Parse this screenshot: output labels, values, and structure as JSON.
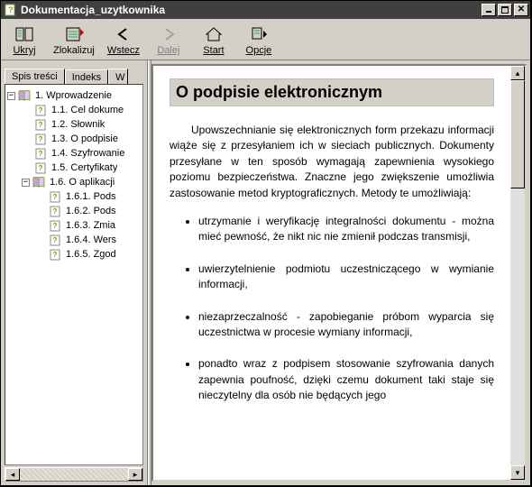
{
  "window": {
    "title": "Dokumentacja_uzytkownika"
  },
  "toolbar": {
    "hide": "Ukryj",
    "locate": "Zlokalizuj",
    "back": "Wstecz",
    "forward": "Dalej",
    "home": "Start",
    "options": "Opcje"
  },
  "tabs": {
    "contents": "Spis treści",
    "index": "Indeks",
    "search_cut": "W"
  },
  "tree": {
    "n1": "1. Wprowadzenie",
    "n11": "1.1. Cel dokume",
    "n12": "1.2. Słownik",
    "n13": "1.3. O podpisie ",
    "n14": "1.4. Szyfrowanie",
    "n15": "1.5. Certyfikaty",
    "n16": "1.6. O aplikacji",
    "n161": "1.6.1. Pods",
    "n162": "1.6.2. Pods",
    "n163": "1.6.3. Zmia",
    "n164": "1.6.4. Wers",
    "n165": "1.6.5. Zgod"
  },
  "page": {
    "heading": "O podpisie elektronicznym",
    "paragraph": "Upowszechnianie się elektronicznych form przekazu informacji wiąże się z przesyłaniem ich w sieciach publicznych. Dokumenty przesyłane w ten sposób wymagają zapewnienia wysokiego poziomu bezpieczeństwa. Znaczne jego zwiększenie umożliwia zastosowanie metod kryptograficznych. Metody te umożliwiają:",
    "li1": "utrzymanie i weryfikację integralności dokumentu - można mieć pewność, że nikt nic nie zmienił podczas transmisji,",
    "li2": "uwierzytelnienie podmiotu uczestniczącego w wymianie informacji,",
    "li3": "niezaprzeczalność - zapobieganie próbom wyparcia się uczestnictwa w procesie wymiany informacji,",
    "li4": "ponadto wraz z podpisem stosowanie szyfrowania danych zapewnia poufność, dzięki czemu dokument taki staje się nieczytelny dla osób nie będących jego"
  }
}
